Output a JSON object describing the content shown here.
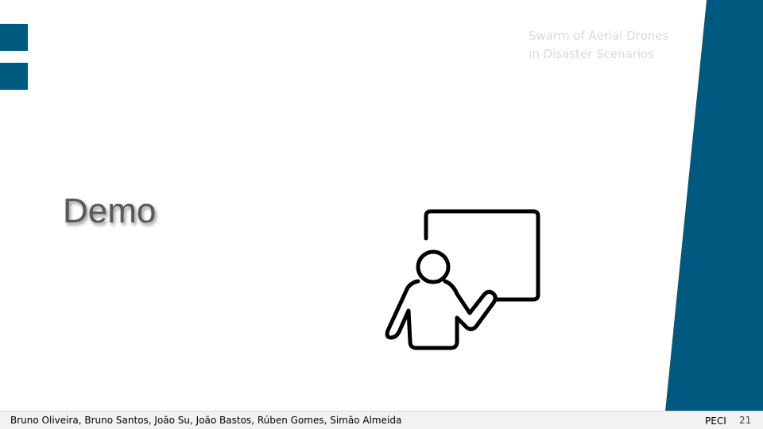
{
  "slide": {
    "header": {
      "subtitle_line1": "Swarm of Aerial Drones",
      "subtitle_line2": "in Disaster Scenarios"
    },
    "section_title": "Demo",
    "illustration_icon": "presenter-whiteboard-icon",
    "footer": {
      "authors": "Bruno Oliveira, Bruno Santos, João Su, João Bastos, Rúben Gomes, Simão Almeida",
      "course": "PECI",
      "page_number": "21"
    }
  },
  "colors": {
    "accent": "#005a80",
    "title_text": "#595959",
    "subtitle_text": "#d9d9d9",
    "footer_background": "#f2f2f2"
  }
}
